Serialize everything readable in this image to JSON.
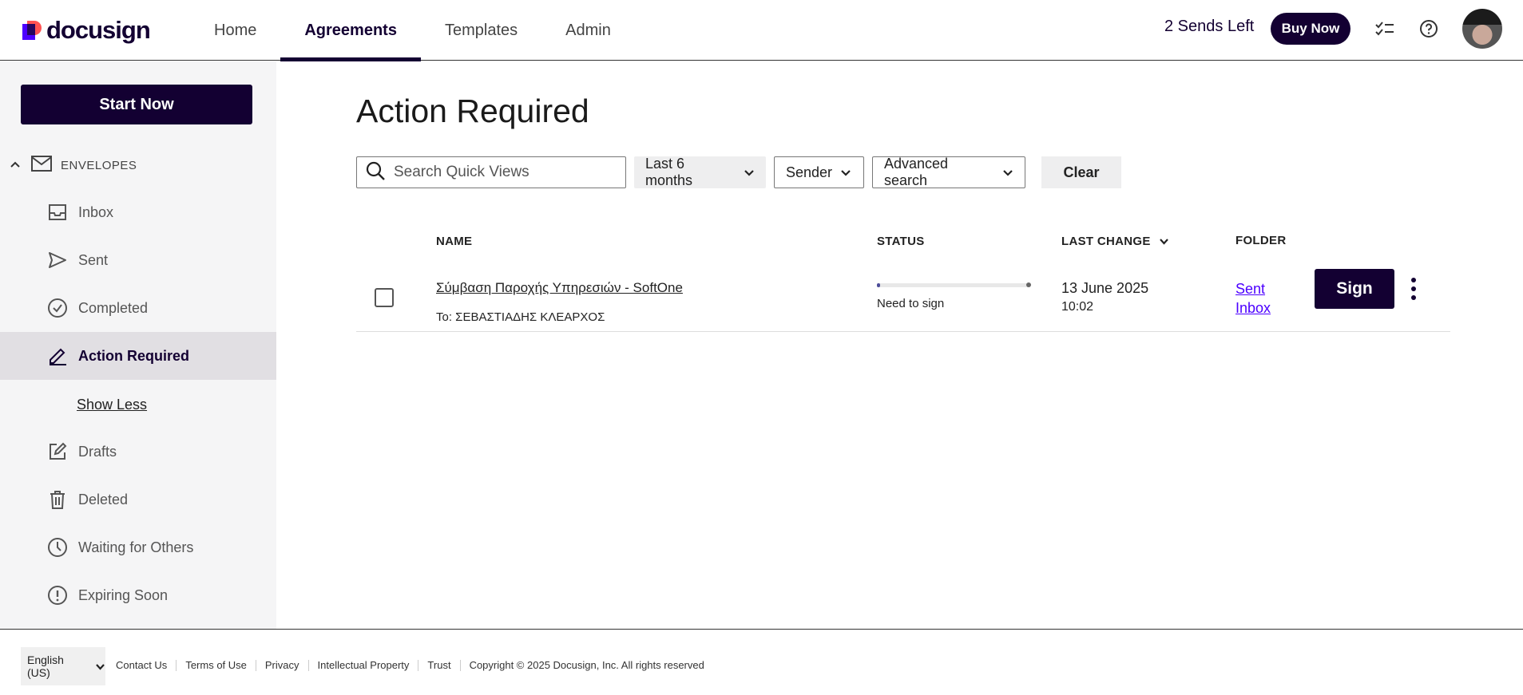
{
  "header": {
    "logo_text": "docusign",
    "nav": [
      {
        "label": "Home"
      },
      {
        "label": "Agreements"
      },
      {
        "label": "Templates"
      },
      {
        "label": "Admin"
      }
    ],
    "sends_left": "2 Sends Left",
    "buy_label": "Buy Now",
    "icons": [
      "tasks-icon",
      "help-icon",
      "avatar"
    ]
  },
  "sidebar": {
    "start_label": "Start Now",
    "envelopes_label": "ENVELOPES",
    "items": [
      {
        "label": "Inbox",
        "icon": "inbox-icon"
      },
      {
        "label": "Sent",
        "icon": "send-icon"
      },
      {
        "label": "Completed",
        "icon": "check-circle-icon"
      },
      {
        "label": "Action Required",
        "icon": "pen-icon"
      },
      {
        "label": "Drafts",
        "icon": "edit-icon"
      },
      {
        "label": "Deleted",
        "icon": "trash-icon"
      },
      {
        "label": "Waiting for Others",
        "icon": "clock-icon"
      },
      {
        "label": "Expiring Soon",
        "icon": "alert-icon"
      }
    ],
    "show_less": "Show Less"
  },
  "main": {
    "title": "Action Required",
    "search_placeholder": "Search Quick Views",
    "filters": {
      "time": "Last 6 months",
      "sender": "Sender",
      "advanced": "Advanced search",
      "clear": "Clear"
    },
    "columns": {
      "name": "NAME",
      "status": "STATUS",
      "last_change": "LAST CHANGE",
      "folder": "FOLDER"
    },
    "rows": [
      {
        "name": "Σύμβαση Παροχής Υπηρεσιών - SoftOne",
        "to": "To: ΣΕΒΑΣΤΙΑΔΗΣ ΚΛΕΑΡΧΟΣ",
        "progress": 0.02,
        "status": "Need to sign",
        "date": "13 June 2025",
        "time": "10:02",
        "folder_line1": "Sent",
        "folder_line2": "Inbox",
        "action": "Sign"
      }
    ]
  },
  "footer": {
    "language": "English (US)",
    "links": [
      "Contact Us",
      "Terms of Use",
      "Privacy",
      "Intellectual Property",
      "Trust"
    ],
    "copyright": "Copyright © 2025 Docusign, Inc. All rights reserved"
  },
  "colors": {
    "brand_dark": "#130032",
    "accent_link": "#4c00ff",
    "sidebar_bg": "#f5f5f6",
    "active_bg": "#e1dfe3"
  }
}
